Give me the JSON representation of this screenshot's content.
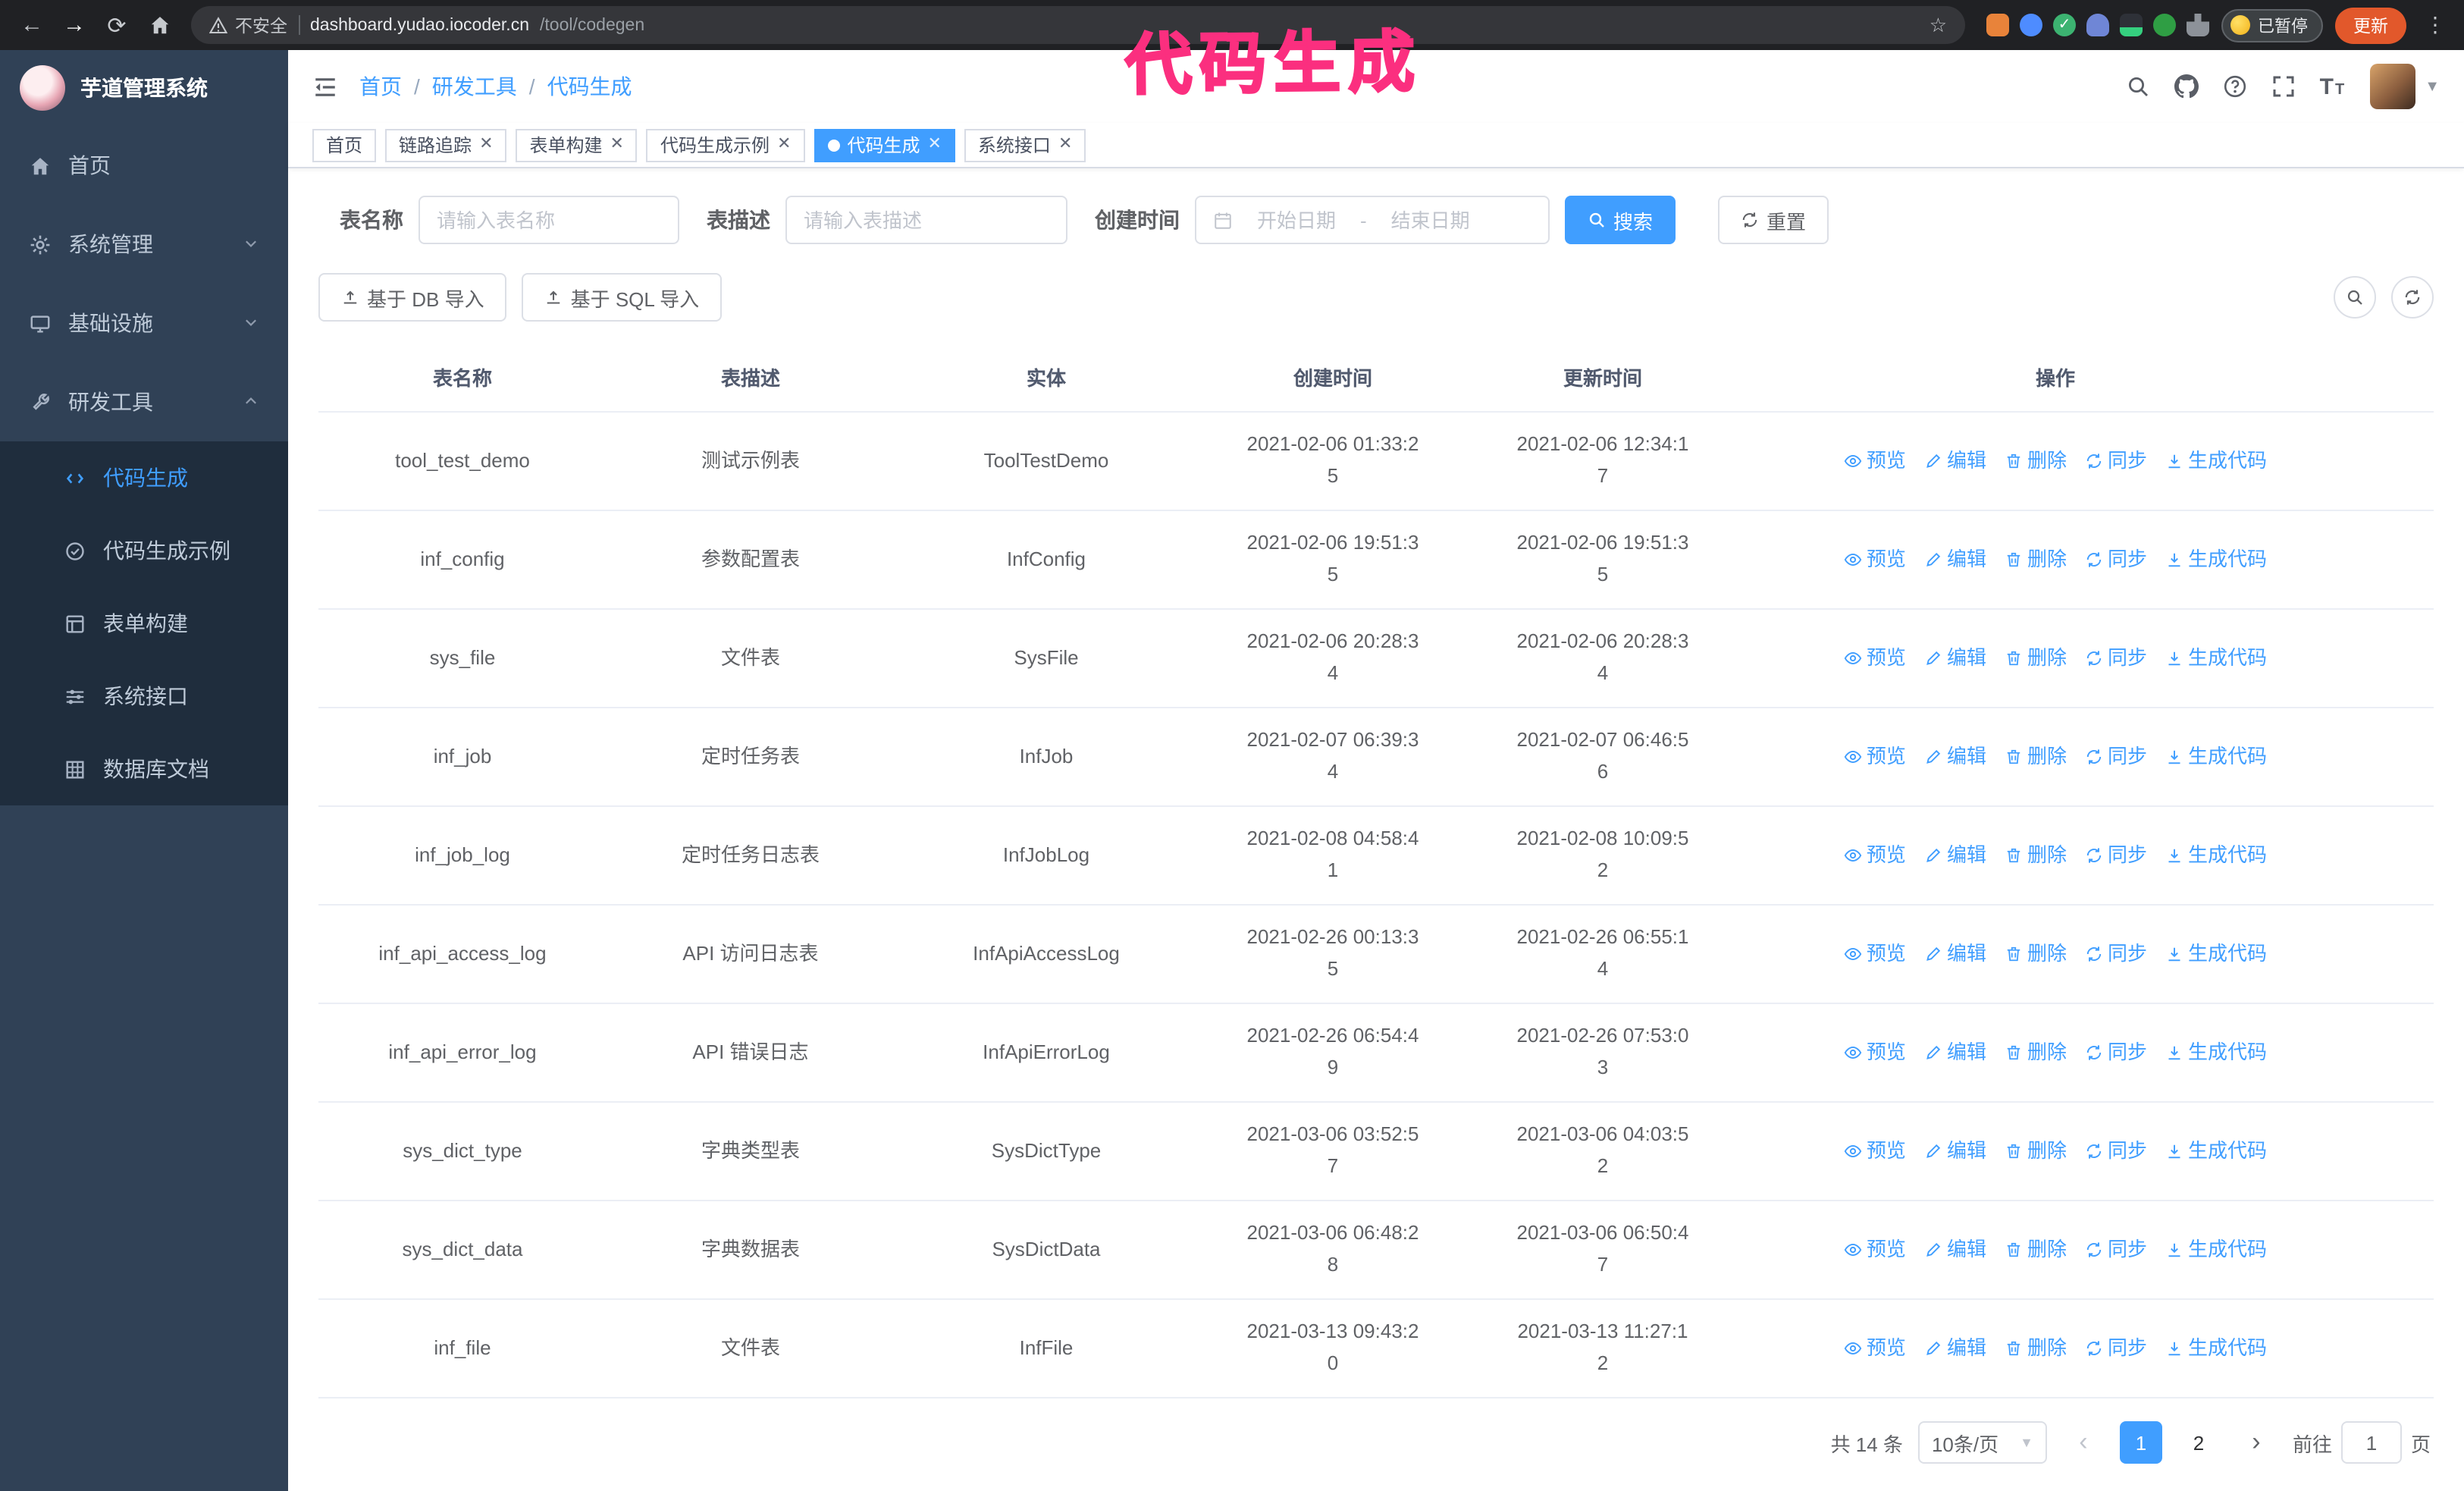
{
  "annotation": {
    "text": "代码生成"
  },
  "colors": {
    "primary": "#409eff",
    "sidebar_bg": "#304156",
    "submenu_bg": "#1f2d3d",
    "annotation_pink": "#fb2f7f",
    "update_button_orange": "#e2582b"
  },
  "browser": {
    "security_label": "不安全",
    "url_host": "dashboard.yudao.iocoder.cn",
    "url_path": "/tool/codegen",
    "paused_badge": "已暂停",
    "update_button": "更新"
  },
  "sidebar": {
    "logo_title": "芋道管理系统",
    "items": [
      {
        "label": "首页"
      },
      {
        "label": "系统管理",
        "chevron": "down"
      },
      {
        "label": "基础设施",
        "chevron": "down"
      },
      {
        "label": "研发工具",
        "chevron": "up"
      }
    ],
    "subitems": [
      {
        "label": "代码生成",
        "active": true
      },
      {
        "label": "代码生成示例"
      },
      {
        "label": "表单构建"
      },
      {
        "label": "系统接口"
      },
      {
        "label": "数据库文档"
      }
    ]
  },
  "header": {
    "breadcrumb": [
      "首页",
      "研发工具",
      "代码生成"
    ],
    "breadcrumb_separator": "/"
  },
  "tabs": [
    {
      "label": "首页",
      "closable": false,
      "active": false
    },
    {
      "label": "链路追踪",
      "closable": true,
      "active": false
    },
    {
      "label": "表单构建",
      "closable": true,
      "active": false
    },
    {
      "label": "代码生成示例",
      "closable": true,
      "active": false
    },
    {
      "label": "代码生成",
      "closable": true,
      "active": true
    },
    {
      "label": "系统接口",
      "closable": true,
      "active": false
    }
  ],
  "filters": {
    "table_name_label": "表名称",
    "table_name_placeholder": "请输入表名称",
    "table_desc_label": "表描述",
    "table_desc_placeholder": "请输入表描述",
    "create_time_label": "创建时间",
    "date_start_placeholder": "开始日期",
    "date_separator": "-",
    "date_end_placeholder": "结束日期",
    "search_button": "搜索",
    "reset_button": "重置"
  },
  "toolbar": {
    "import_db_button": "基于 DB 导入",
    "import_sql_button": "基于 SQL 导入"
  },
  "table": {
    "columns": [
      "表名称",
      "表描述",
      "实体",
      "创建时间",
      "更新时间",
      "操作"
    ],
    "actions": [
      "预览",
      "编辑",
      "删除",
      "同步",
      "生成代码"
    ],
    "rows": [
      {
        "name": "tool_test_demo",
        "desc": "测试示例表",
        "entity": "ToolTestDemo",
        "created": "2021-02-06 01:33:25",
        "updated": "2021-02-06 12:34:17"
      },
      {
        "name": "inf_config",
        "desc": "参数配置表",
        "entity": "InfConfig",
        "created": "2021-02-06 19:51:35",
        "updated": "2021-02-06 19:51:35"
      },
      {
        "name": "sys_file",
        "desc": "文件表",
        "entity": "SysFile",
        "created": "2021-02-06 20:28:34",
        "updated": "2021-02-06 20:28:34"
      },
      {
        "name": "inf_job",
        "desc": "定时任务表",
        "entity": "InfJob",
        "created": "2021-02-07 06:39:34",
        "updated": "2021-02-07 06:46:56"
      },
      {
        "name": "inf_job_log",
        "desc": "定时任务日志表",
        "entity": "InfJobLog",
        "created": "2021-02-08 04:58:41",
        "updated": "2021-02-08 10:09:52"
      },
      {
        "name": "inf_api_access_log",
        "desc": "API 访问日志表",
        "entity": "InfApiAccessLog",
        "created": "2021-02-26 00:13:35",
        "updated": "2021-02-26 06:55:14"
      },
      {
        "name": "inf_api_error_log",
        "desc": "API 错误日志",
        "entity": "InfApiErrorLog",
        "created": "2021-02-26 06:54:49",
        "updated": "2021-02-26 07:53:03"
      },
      {
        "name": "sys_dict_type",
        "desc": "字典类型表",
        "entity": "SysDictType",
        "created": "2021-03-06 03:52:57",
        "updated": "2021-03-06 04:03:52"
      },
      {
        "name": "sys_dict_data",
        "desc": "字典数据表",
        "entity": "SysDictData",
        "created": "2021-03-06 06:48:28",
        "updated": "2021-03-06 06:50:47"
      },
      {
        "name": "inf_file",
        "desc": "文件表",
        "entity": "InfFile",
        "created": "2021-03-13 09:43:20",
        "updated": "2021-03-13 11:27:12"
      }
    ]
  },
  "pagination": {
    "total": "共 14 条",
    "page_size": "10条/页",
    "pages": [
      "1",
      "2"
    ],
    "active_page": "1",
    "goto_label": "前往",
    "goto_value": "1",
    "page_suffix": "页"
  }
}
